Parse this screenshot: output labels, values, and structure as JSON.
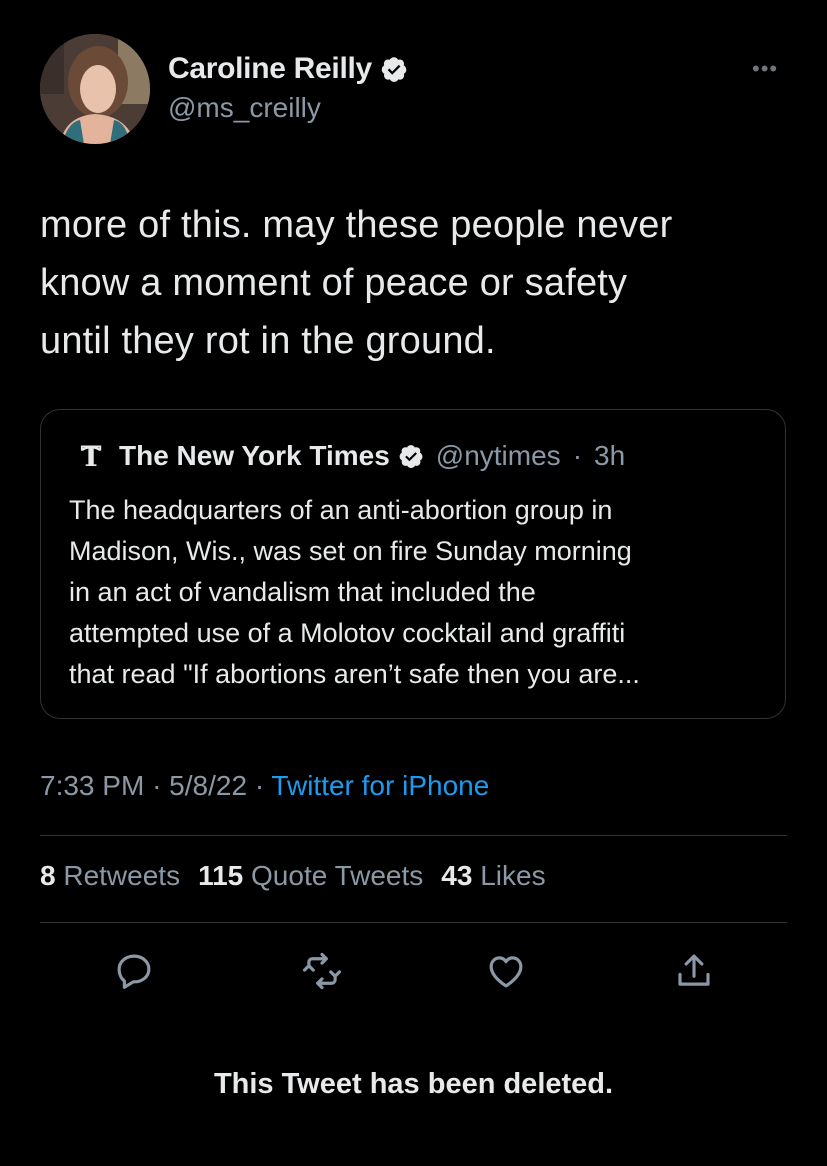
{
  "author": {
    "display_name": "Caroline Reilly",
    "handle": "@ms_creilly",
    "verified": true,
    "avatar": "profile-photo"
  },
  "more_icon": "more-horizontal-icon",
  "tweet": {
    "line1": "more of this. may these people never",
    "line2": "know a moment of peace or safety",
    "line3": "until they rot in the ground."
  },
  "quoted_tweet": {
    "logo": "nyt-logo-icon",
    "display_name": "The New York Times",
    "handle": "@nytimes",
    "separator": "·",
    "time_ago": "3h",
    "line1": "The headquarters of an anti-abortion group in",
    "line2": "Madison, Wis., was set on fire Sunday morning",
    "line3": "in an act of vandalism that included the",
    "line4": "attempted use of a Molotov cocktail and graffiti",
    "line5": "that read \"If abortions aren’t safe then you are..."
  },
  "meta": {
    "time": "7:33 PM",
    "separator": "·",
    "date": "5/8/22",
    "source": "Twitter for iPhone"
  },
  "stats": {
    "retweets_count": "8",
    "retweets_label": "Retweets",
    "quotes_count": "115",
    "quotes_label": "Quote Tweets",
    "likes_count": "43",
    "likes_label": "Likes"
  },
  "actions": [
    "reply-icon",
    "retweet-icon",
    "like-icon",
    "share-icon"
  ],
  "deleted_notice": "This Tweet has been deleted.",
  "colors": {
    "background": "#000000",
    "text_primary": "#e7e9ea",
    "text_secondary": "#8b98a5",
    "accent": "#1d9bf0",
    "border": "#2f3336"
  }
}
